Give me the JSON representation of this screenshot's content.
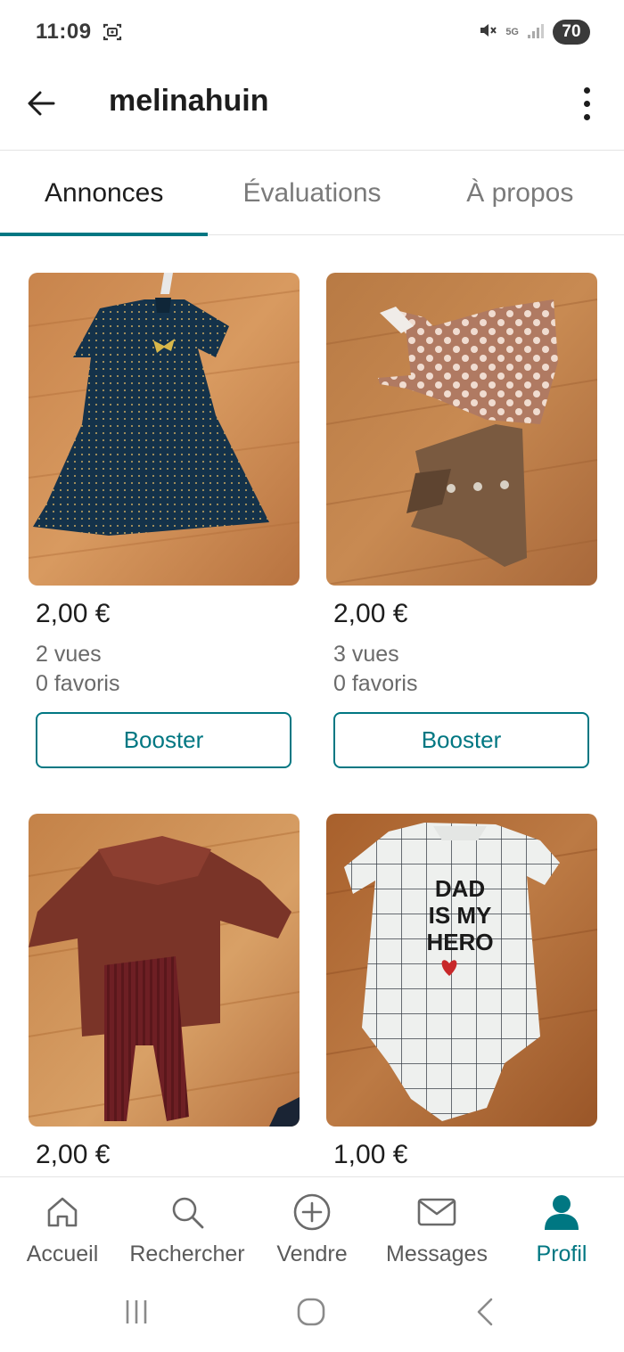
{
  "status_bar": {
    "time": "11:09",
    "network": "5G",
    "battery": "70"
  },
  "header": {
    "title": "melinahuin"
  },
  "tabs": [
    {
      "label": "Annonces",
      "active": true
    },
    {
      "label": "Évaluations",
      "active": false
    },
    {
      "label": "À propos",
      "active": false
    }
  ],
  "listings": [
    {
      "price": "2,00 €",
      "views": "2 vues",
      "favorites": "0 favoris",
      "boost_label": "Booster",
      "photo": "navy dotted baby dress"
    },
    {
      "price": "2,00 €",
      "views": "3 vues",
      "favorites": "0 favoris",
      "boost_label": "Booster",
      "photo": "polka dot top and brown bow headband"
    },
    {
      "price": "2,00 €",
      "photo": "burgundy sweater and ribbed leggings"
    },
    {
      "price": "1,00 €",
      "photo": "white grid bodysuit",
      "print_text": [
        "DAD",
        "IS MY",
        "HERO"
      ]
    }
  ],
  "bottom_nav": [
    {
      "label": "Accueil",
      "icon": "home-icon",
      "active": false
    },
    {
      "label": "Rechercher",
      "icon": "search-icon",
      "active": false
    },
    {
      "label": "Vendre",
      "icon": "plus-circle-icon",
      "active": false
    },
    {
      "label": "Messages",
      "icon": "mail-icon",
      "active": false
    },
    {
      "label": "Profil",
      "icon": "profile-icon",
      "active": true
    }
  ],
  "colors": {
    "accent": "#007782",
    "text": "#1d1d1d",
    "muted": "#6a6a6a",
    "divider": "#e4e4e4"
  }
}
